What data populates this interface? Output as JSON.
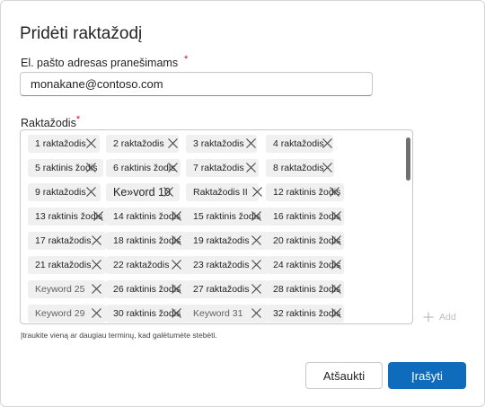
{
  "dialog": {
    "title": "Pridėti raktažodį",
    "email_label": "El. pašto adresas pranešimams",
    "required_mark": "*",
    "email_value": "monakane@contoso.com",
    "keywords_label": "Raktažodis",
    "hint": "Įtraukite vieną ar daugiau terminų, kad galėtumėte stebėti.",
    "add_label": "Add",
    "cancel_label": "Atšaukti",
    "save_label": "Įrašyti"
  },
  "keywords": [
    "1 raktažodis",
    "2 raktažodis",
    "3 raktažodis",
    "4 raktažodis",
    "5 raktinis žodis",
    "6 raktinis žodis",
    "7 raktažodis",
    "8 raktažodis",
    "9 raktažodis",
    "Ke»vord 10",
    "Raktažodis II",
    "12 raktinis žodis",
    "13 raktinis žodis",
    "14 raktinis žodis",
    "15 raktinis žodis",
    "16 raktinis žodis",
    "17 raktažodis",
    "18 raktinis žodis",
    "19 raktažodis",
    "20 raktinis žodis",
    "21 raktažodis",
    "22 raktažodis",
    "23 raktažodis",
    "24 raktinis žodis",
    "Keyword 25",
    "26 raktinis žodis",
    "27 raktažodis",
    "28 raktinis žodis",
    "Keyword 29",
    "30 raktinis žodis",
    "Keyword 31",
    "32 raktinis žodis"
  ],
  "icons": {
    "remove": "close-icon",
    "add": "plus-icon"
  },
  "colors": {
    "primary": "#0f6cbd",
    "required": "#c50f1f",
    "tag_bg": "#f0f0f0"
  }
}
